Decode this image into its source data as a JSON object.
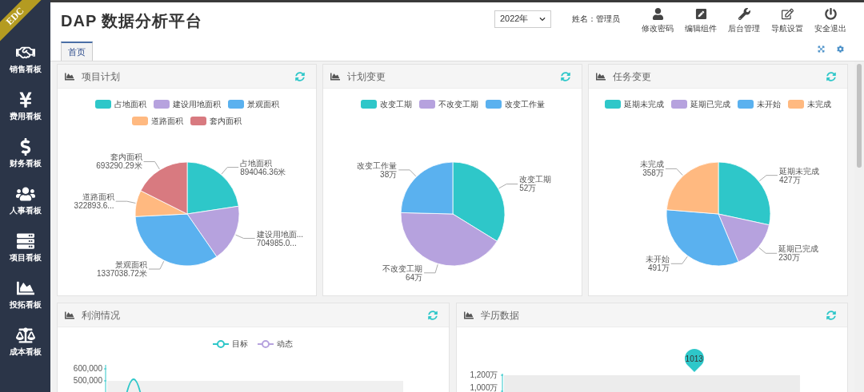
{
  "ribbon": "EDC",
  "sidebar": {
    "items": [
      {
        "label": "销售看板"
      },
      {
        "label": "费用看板"
      },
      {
        "label": "财务看板"
      },
      {
        "label": "人事看板"
      },
      {
        "label": "项目看板"
      },
      {
        "label": "投拓看板"
      },
      {
        "label": "成本看板"
      }
    ]
  },
  "header": {
    "title": "DAP 数据分析平台",
    "year_select": {
      "value": "2022年"
    },
    "user": "姓名：管理员",
    "actions": [
      {
        "label": "修改密码"
      },
      {
        "label": "编辑组件"
      },
      {
        "label": "后台管理"
      },
      {
        "label": "导航设置"
      },
      {
        "label": "安全退出"
      }
    ]
  },
  "tabs": [
    {
      "label": "首页",
      "selected": true
    }
  ],
  "panels": [
    {
      "title": "项目计划",
      "chart_data": {
        "type": "pie",
        "categories": [
          "占地面积",
          "建设用地面积",
          "景观面积",
          "道路面积",
          "套内面积"
        ],
        "values": [
          22.6,
          17.8,
          33.8,
          8.2,
          17.6
        ],
        "colors": [
          "#2ec7c9",
          "#b6a2de",
          "#5ab1ef",
          "#ffb980",
          "#d87a80"
        ]
      },
      "slice_labels": [
        {
          "name": "占地面积",
          "value": "894046.36米"
        },
        {
          "name": "建设用地面...",
          "value": "704985.0..."
        },
        {
          "name": "景观面积",
          "value": "1337038.72米"
        },
        {
          "name": "道路面积",
          "value": "322893.6..."
        },
        {
          "name": "套内面积",
          "value": "693290.29米"
        }
      ]
    },
    {
      "title": "计划变更",
      "chart_data": {
        "type": "pie",
        "categories": [
          "改变工期",
          "不改变工期",
          "改变工作量"
        ],
        "values": [
          33.8,
          41.6,
          24.6
        ],
        "colors": [
          "#2ec7c9",
          "#b6a2de",
          "#5ab1ef"
        ]
      },
      "slice_labels": [
        {
          "name": "改变工期",
          "value": "52万"
        },
        {
          "name": "不改变工期",
          "value": "64万"
        },
        {
          "name": "改变工作量",
          "value": "38万"
        }
      ]
    },
    {
      "title": "任务变更",
      "chart_data": {
        "type": "pie",
        "categories": [
          "延期未完成",
          "延期已完成",
          "未开始",
          "未完成"
        ],
        "values": [
          28.4,
          15.3,
          32.6,
          23.7
        ],
        "colors": [
          "#2ec7c9",
          "#b6a2de",
          "#5ab1ef",
          "#ffb980"
        ]
      },
      "slice_labels": [
        {
          "name": "延期未完成",
          "value": "427万"
        },
        {
          "name": "延期已完成",
          "value": "230万"
        },
        {
          "name": "未开始",
          "value": "491万"
        },
        {
          "name": "未完成",
          "value": "358万"
        }
      ]
    }
  ],
  "lower_panels": [
    {
      "title": "利润情况",
      "legend": [
        {
          "name": "目标",
          "color": "#2ec7c9"
        },
        {
          "name": "动态",
          "color": "#b6a2de"
        }
      ],
      "y_axis_labels": [
        "600,000",
        "500,000"
      ]
    },
    {
      "title": "学历数据",
      "y_axis_labels": [
        "1,200万",
        "1,000万"
      ],
      "marker_label": "1013"
    }
  ]
}
